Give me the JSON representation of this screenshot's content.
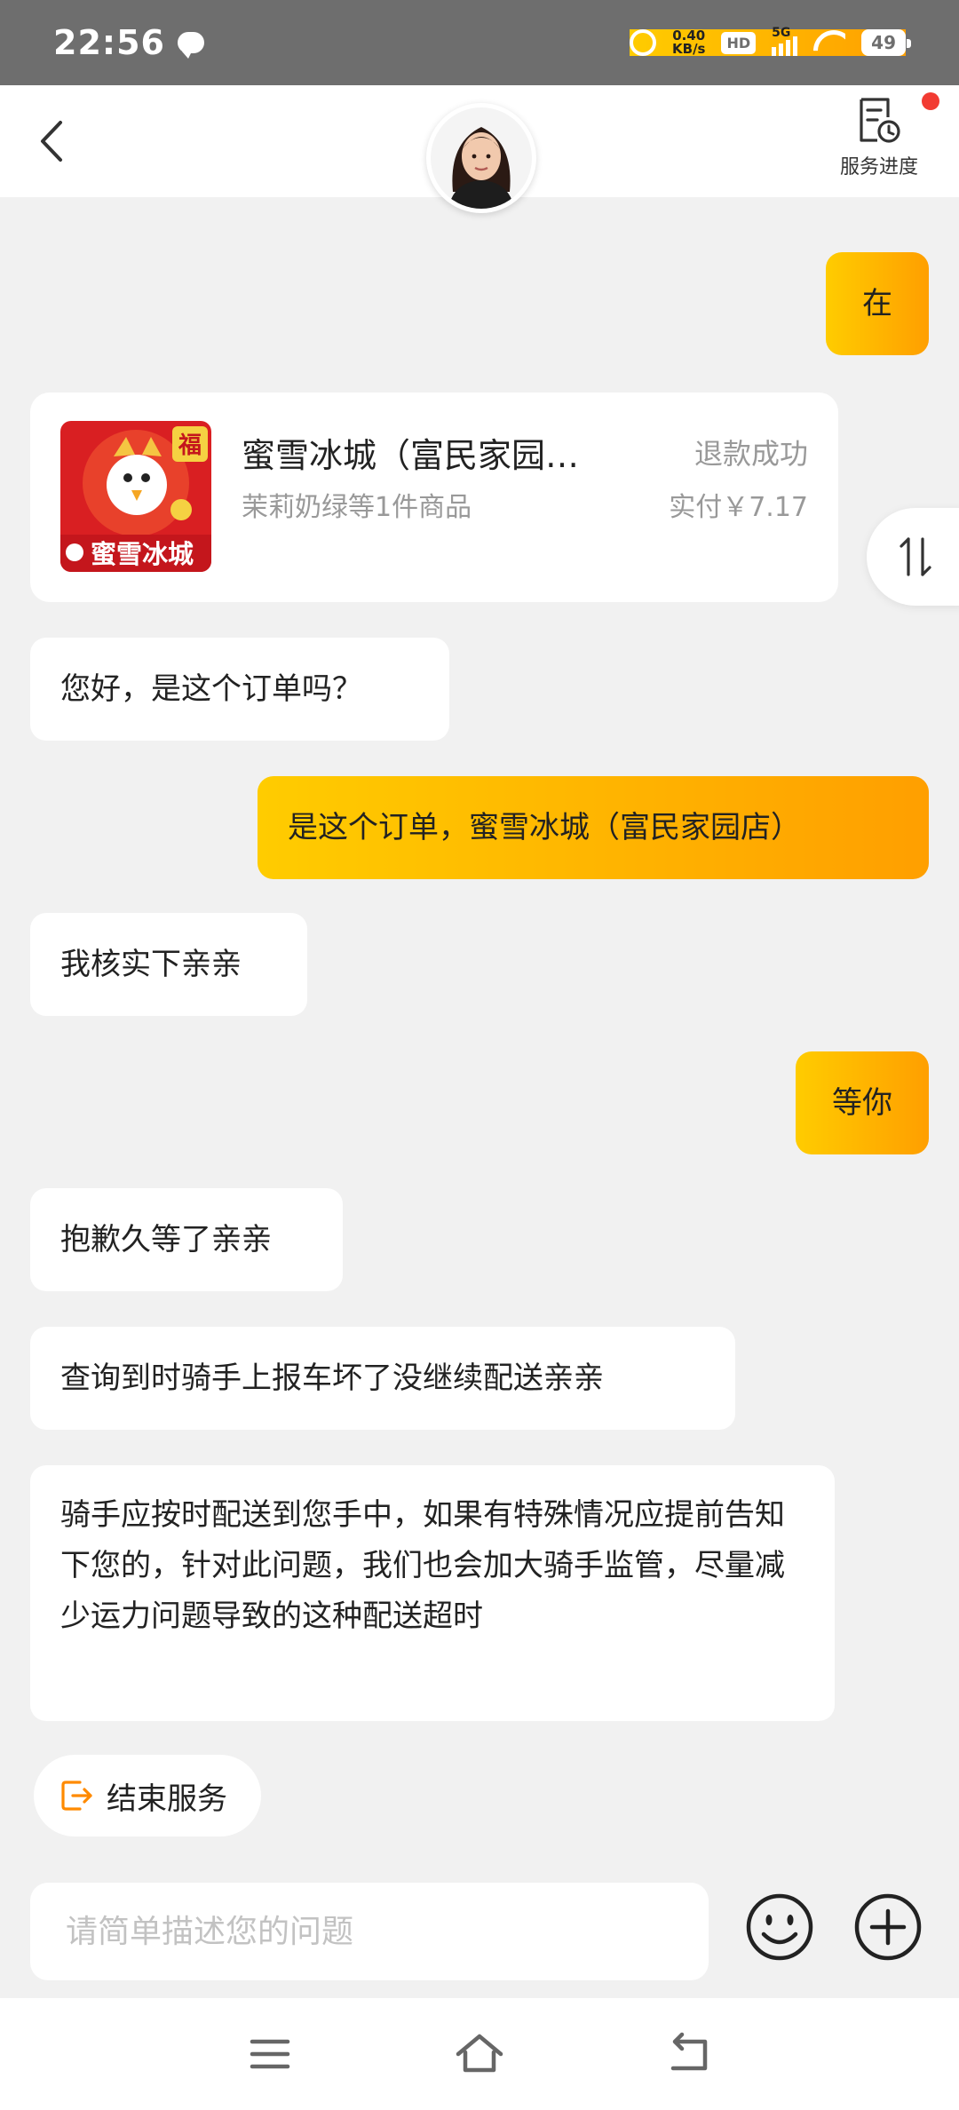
{
  "status_bar": {
    "time": "22:56",
    "net_speed_value": "0.40",
    "net_speed_unit": "KB/s",
    "hd_label": "HD",
    "network": "5G",
    "battery": "49"
  },
  "header": {
    "service_progress_label": "服务进度",
    "has_notification": true
  },
  "messages": [
    {
      "side": "right",
      "text": "在"
    },
    {
      "side": "left",
      "text": "您好，是这个订单吗？"
    },
    {
      "side": "right",
      "text": "是这个订单，蜜雪冰城（富民家园店）"
    },
    {
      "side": "left",
      "text": "我核实下亲亲"
    },
    {
      "side": "right",
      "text": "等你"
    },
    {
      "side": "left",
      "text": "抱歉久等了亲亲"
    },
    {
      "side": "left",
      "text": "查询到时骑手上报车坏了没继续配送亲亲"
    },
    {
      "side": "left",
      "text": "骑手应按时配送到您手中，如果有特殊情况应提前告知下您的，针对此问题，我们也会加大骑手监管，尽量减少运力问题导致的这种配送超时"
    }
  ],
  "order_card": {
    "shop_name": "蜜雪冰城（富民家园…",
    "status": "退款成功",
    "items_summary": "茉莉奶绿等1件商品",
    "paid": "实付￥7.17",
    "logo_text": "蜜雪冰城",
    "logo_badge": "福"
  },
  "end_service_label": "结束服务",
  "input": {
    "placeholder": "请简单描述您的问题",
    "value": ""
  },
  "colors": {
    "accent_start": "#ffcc00",
    "accent_end": "#ff9f00",
    "end_icon": "#ff8a00",
    "logo_red": "#e21b23"
  }
}
